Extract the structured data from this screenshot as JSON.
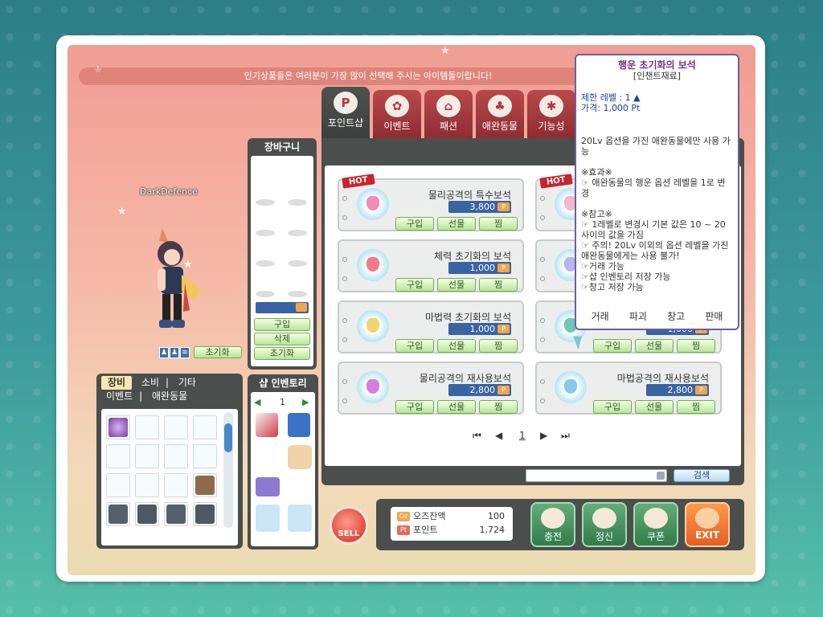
{
  "banner": "인기상품들은 여러분이 가장 많이 선택해 주시는 아이템들이랍니다!",
  "character": {
    "name": "DarkDefence",
    "reset_label": "초기화",
    "mini_icons": [
      "walk-icon",
      "walk-icon",
      "list-icon"
    ]
  },
  "cart": {
    "title": "장바구니",
    "buy": "구입",
    "delete": "삭제",
    "reset": "초기화"
  },
  "inventory": {
    "tabs": [
      "장비",
      "소비",
      "기타",
      "이벤트",
      "애완동물"
    ],
    "active_tab": "장비"
  },
  "shop_inventory": {
    "title": "샵 인벤토리",
    "page": "1"
  },
  "tabs": [
    {
      "label": "포인트샵",
      "icon": "point-icon",
      "active": true
    },
    {
      "label": "이벤트",
      "icon": "flower-icon",
      "active": false
    },
    {
      "label": "패션",
      "icon": "hanger-icon",
      "active": false
    },
    {
      "label": "애완동물",
      "icon": "pet-icon",
      "active": false
    },
    {
      "label": "기능성",
      "icon": "gears-icon",
      "active": false
    }
  ],
  "items": [
    {
      "name": "물리공격의 특수보석",
      "price": "3,800",
      "hot": true,
      "color": "#f08ab8"
    },
    {
      "name": "",
      "price": "",
      "hot": true,
      "color": "#f3b7c7"
    },
    {
      "name": "체력 초기화의 보석",
      "price": "1,000",
      "hot": false,
      "color": "#f27a8a"
    },
    {
      "name": "",
      "price": "",
      "hot": false,
      "color": "#b7b6ee"
    },
    {
      "name": "마법력 초기화의 보석",
      "price": "1,000",
      "hot": false,
      "color": "#f1d46a"
    },
    {
      "name": "",
      "price": "1,000",
      "hot": false,
      "color": "#6fc7b6"
    },
    {
      "name": "물리공격의 재사용보석",
      "price": "2,800",
      "hot": false,
      "color": "#d57ee0"
    },
    {
      "name": "마법공격의 재사용보석",
      "price": "2,800",
      "hot": false,
      "color": "#86c9e8"
    }
  ],
  "item_buttons": {
    "buy": "구입",
    "gift": "선물",
    "wish": "찜",
    "hot_label": "HOT",
    "pt_mark": "P"
  },
  "pager": {
    "page": "1"
  },
  "search": {
    "button": "검색",
    "value": ""
  },
  "sell_label": "SELL",
  "balance": {
    "cash_label": "오즈잔액",
    "cash_value": "100",
    "point_label": "포인트",
    "point_value": "1,724"
  },
  "bottom_buttons": {
    "charge": "충전",
    "refresh": "정신",
    "coupon": "쿠폰",
    "exit": "EXIT"
  },
  "tooltip": {
    "title": "행운 초기화의 보석",
    "subtitle": "[인챈트재료]",
    "level": "제한 레벨 : 1 ▲",
    "price": "가격: 1,000 Pt",
    "desc": "20Lv 옵션을 가진 애완동물에만 사용 가능",
    "effect_head": "※효과※",
    "effect": "☞ 애완동물의 행운 옵션 레벨을 1로 변경",
    "note_head": "※참고※",
    "notes": [
      "☞ 1레벨로 변경시 기본 값은 10 ~ 20 사이의 값을 가짐",
      "☞ 주의! 20Lv 이외의 옵션 레벨을 가진 애완동물에게는 사용 불가!",
      "☞거래 가능",
      "☞샵 인벤토리 저장 가능",
      "☞창고 저장 가능"
    ],
    "actions": [
      "거래",
      "파괴",
      "창고",
      "판매"
    ]
  }
}
